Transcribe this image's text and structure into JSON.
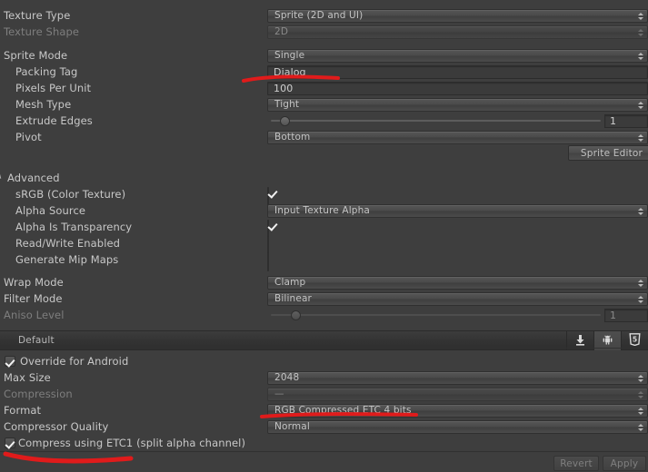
{
  "theme": {
    "background": "#3e3e3e",
    "label": "#c8c8c8",
    "dim_label": "#7e7e7e",
    "accent_red": "#e01b1b"
  },
  "texture_import": {
    "texture_type": {
      "label": "Texture Type",
      "value": "Sprite (2D and UI)"
    },
    "texture_shape": {
      "label": "Texture Shape",
      "value": "2D"
    },
    "sprite_mode": {
      "label": "Sprite Mode",
      "value": "Single"
    },
    "packing_tag": {
      "label": "Packing Tag",
      "value": "Dialog"
    },
    "pixels_per_unit": {
      "label": "Pixels Per Unit",
      "value": "100"
    },
    "mesh_type": {
      "label": "Mesh Type",
      "value": "Tight"
    },
    "extrude_edges": {
      "label": "Extrude Edges",
      "value": "1"
    },
    "pivot": {
      "label": "Pivot",
      "value": "Bottom"
    },
    "sprite_editor_button": "Sprite Editor"
  },
  "advanced": {
    "header": "Advanced",
    "srgb": {
      "label": "sRGB (Color Texture)",
      "checked": true
    },
    "alpha_source": {
      "label": "Alpha Source",
      "value": "Input Texture Alpha"
    },
    "alpha_is_transparency": {
      "label": "Alpha Is Transparency",
      "checked": true
    },
    "read_write_enabled": {
      "label": "Read/Write Enabled",
      "checked": false
    },
    "generate_mip_maps": {
      "label": "Generate Mip Maps",
      "checked": false
    }
  },
  "filtering": {
    "wrap_mode": {
      "label": "Wrap Mode",
      "value": "Clamp"
    },
    "filter_mode": {
      "label": "Filter Mode",
      "value": "Bilinear"
    },
    "aniso_level": {
      "label": "Aniso Level",
      "value": "1"
    }
  },
  "platforms": {
    "default_tab": "Default",
    "tabs": [
      {
        "name": "standalone-icon",
        "selected": false
      },
      {
        "name": "android-icon",
        "selected": true
      },
      {
        "name": "webgl-html5-icon",
        "selected": false
      }
    ]
  },
  "android_override": {
    "override_checkbox": {
      "label": "Override for Android",
      "checked": true
    },
    "max_size": {
      "label": "Max Size",
      "value": "2048"
    },
    "compression": {
      "label": "Compression",
      "value": "—"
    },
    "format": {
      "label": "Format",
      "value": "RGB Compressed ETC 4 bits"
    },
    "compressor_quality": {
      "label": "Compressor Quality",
      "value": "Normal"
    },
    "compress_etc1": {
      "label": "Compress using ETC1 (split alpha channel)",
      "checked": true
    }
  },
  "footer": {
    "revert": "Revert",
    "apply": "Apply"
  }
}
